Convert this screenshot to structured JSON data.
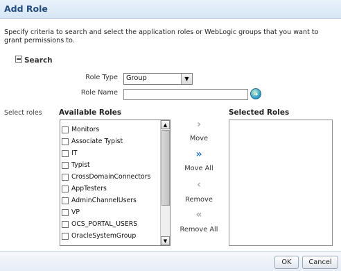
{
  "dialog": {
    "title": "Add Role",
    "description": "Specify criteria to search and select the application roles or WebLogic groups that you want to grant permissions to."
  },
  "search": {
    "section_label": "Search",
    "role_type_label": "Role Type",
    "role_type_value": "Group",
    "role_name_label": "Role Name",
    "role_name_value": ""
  },
  "shuttle": {
    "select_roles_label": "Select roles",
    "available_header": "Available Roles",
    "selected_header": "Selected Roles",
    "available_items": [
      "Monitors",
      "Associate Typist",
      "IT",
      "Typist",
      "CrossDomainConnectors",
      "AppTesters",
      "AdminChannelUsers",
      "VP",
      "OCS_PORTAL_USERS",
      "OracleSystemGroup"
    ],
    "move_label": "Move",
    "move_all_label": "Move All",
    "remove_label": "Remove",
    "remove_all_label": "Remove All"
  },
  "footer": {
    "ok_label": "OK",
    "cancel_label": "Cancel"
  },
  "icons": {
    "move": "chevron-right-icon",
    "move_all": "double-chevron-right-icon",
    "remove": "chevron-left-icon",
    "remove_all": "double-chevron-left-icon",
    "go": "go-arrow-icon"
  },
  "colors": {
    "title_text": "#234b7c",
    "active_arrow": "#2a76c6",
    "disabled_arrow": "#a9a9a9"
  }
}
